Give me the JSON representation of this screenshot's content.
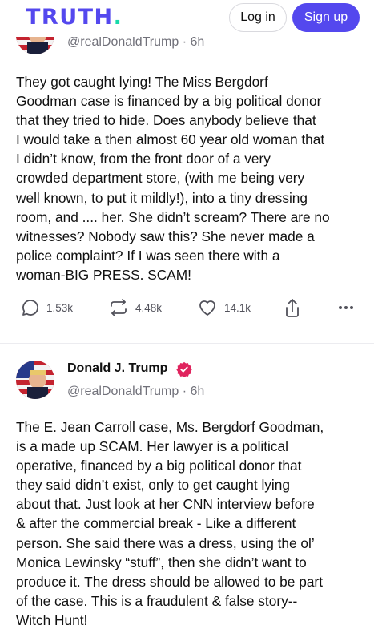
{
  "header": {
    "logo_text": "TRUTH",
    "logo_dot": ".",
    "login_label": "Log in",
    "signup_label": "Sign up",
    "colors": {
      "brand": "#5448ee",
      "accent": "#17d9a9"
    }
  },
  "posts": [
    {
      "handle": "@realDonaldTrump · 6h",
      "text": "They got caught lying! The Miss Bergdorf\nGoodman case is financed by a big political donor\nthat they tried to hide. Does anybody believe that\nI would take a then almost 60 year old woman that\nI didn’t know, from the front door of a very\ncrowded department store, (with me being very\nwell known, to put it mildly!), into a tiny dressing\nroom, and .... her. She didn’t scream? There are no\nwitnesses? Nobody saw this? She never made a\npolice complaint? If I was seen there with a\nwoman-BIG PRESS. SCAM!",
      "replies": "1.53k",
      "retruths": "4.48k",
      "likes": "14.1k"
    },
    {
      "display_name": "Donald J. Trump",
      "handle": "@realDonaldTrump · 6h",
      "text": "The E. Jean Carroll case, Ms. Bergdorf Goodman,\nis a made up SCAM. Her lawyer is a political\noperative, financed by a big political donor that\nthey said didn’t exist, only to get caught lying\nabout that. Just look at her CNN interview before\n& after the commercial break - Like a different\nperson. She said there was a dress, using the ol’\nMonica Lewinsky “stuff”, then she didn’t want to\nproduce it. The dress should be allowed to be part\nof the case. This is a fraudulent & false story--\nWitch Hunt!"
    }
  ],
  "icons": [
    "reply-icon",
    "retruth-icon",
    "heart-icon",
    "share-icon",
    "more-icon",
    "verified-icon"
  ],
  "verified_color": "#e0245e"
}
